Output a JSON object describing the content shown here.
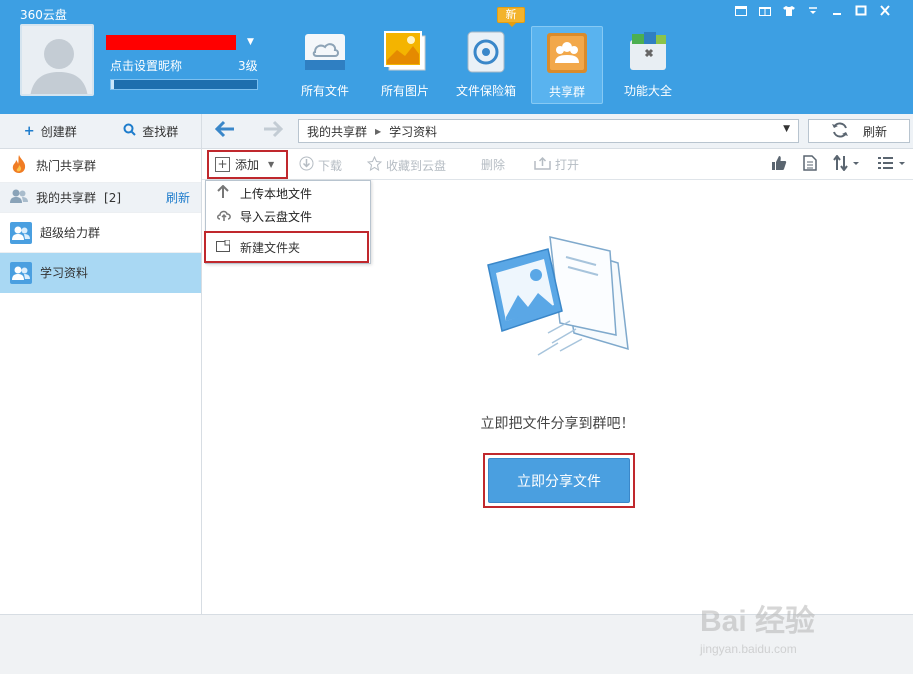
{
  "app": {
    "title": "360云盘"
  },
  "header": {
    "set_nickname": "点击设置昵称",
    "level": "3级",
    "level_progress": 0.02,
    "new_badge": "新",
    "tabs": [
      {
        "label": "所有文件",
        "icon": "cloud-folder-icon"
      },
      {
        "label": "所有图片",
        "icon": "photos-icon"
      },
      {
        "label": "文件保险箱",
        "icon": "safe-icon"
      },
      {
        "label": "共享群",
        "icon": "group-share-icon",
        "active": true
      },
      {
        "label": "功能大全",
        "icon": "toolbox-icon"
      }
    ]
  },
  "sidebar": {
    "create_group": "创建群",
    "find_group": "查找群",
    "hot_groups": "热门共享群",
    "my_groups": "我的共享群",
    "my_groups_count": "[2]",
    "refresh": "刷新",
    "groups": [
      {
        "name": "超级给力群"
      },
      {
        "name": "学习资料",
        "selected": true
      }
    ]
  },
  "addressbar": {
    "path": [
      "我的共享群",
      "学习资料"
    ],
    "refresh": "刷新"
  },
  "toolbar": {
    "add": "添加",
    "download": "下载",
    "save_to_cloud": "收藏到云盘",
    "delete": "删除",
    "open": "打开"
  },
  "dropdown": {
    "upload_local": "上传本地文件",
    "import_cloud": "导入云盘文件",
    "new_folder": "新建文件夹"
  },
  "main": {
    "empty_text": "立即把文件分享到群吧！",
    "share_button": "立即分享文件"
  },
  "watermark": {
    "brand": "Bai 经验",
    "url": "jingyan.baidu.com"
  },
  "colors": {
    "header_blue": "#3d9fe3",
    "selected_row": "#a9d8f3",
    "highlight_red": "#c0282d",
    "button_blue": "#4a9fe0"
  }
}
